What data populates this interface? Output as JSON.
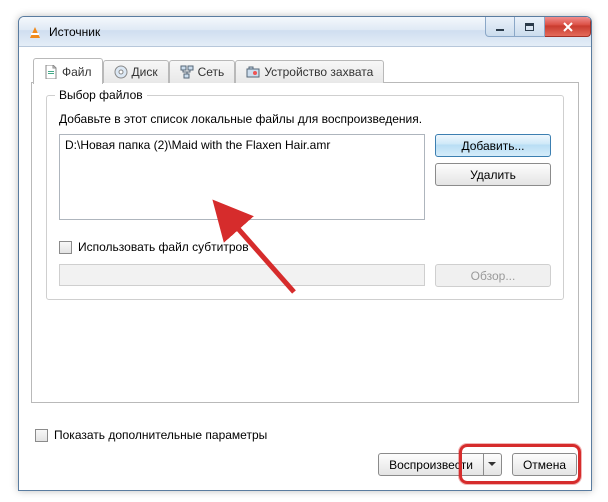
{
  "window": {
    "title": "Источник"
  },
  "tabs": {
    "file": "Файл",
    "disc": "Диск",
    "network": "Сеть",
    "capture": "Устройство захвата"
  },
  "file_panel": {
    "group_title": "Выбор файлов",
    "help": "Добавьте в этот список локальные файлы для воспроизведения.",
    "items": [
      "D:\\Новая папка (2)\\Maid with the Flaxen Hair.amr"
    ],
    "add_btn": "Добавить...",
    "remove_btn": "Удалить",
    "subs_checkbox": "Использовать файл субтитров",
    "browse_btn": "Обзор..."
  },
  "footer": {
    "more_options": "Показать дополнительные параметры",
    "play_btn": "Воспроизвести",
    "cancel_btn": "Отмена"
  }
}
